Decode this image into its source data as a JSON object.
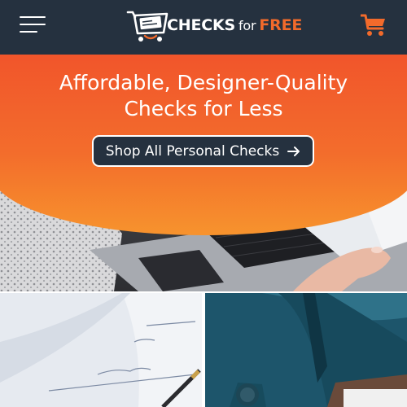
{
  "header": {
    "logo": {
      "word1": "CHECKS",
      "word2": "for",
      "word3": "FREE"
    },
    "menu_icon": "hamburger-menu-icon",
    "cart_icon": "shopping-cart-icon"
  },
  "hero": {
    "headline_line1": "Affordable, Designer-Quality",
    "headline_line2": "Checks for Less",
    "cta_label": "Shop All Personal Checks",
    "cta_icon": "arrow-right-icon"
  },
  "colors": {
    "header_bg": "#25313f",
    "accent_orange": "#f26a2b",
    "banner_top": "#f1552b",
    "banner_bottom": "#f7932d",
    "white": "#ffffff"
  }
}
